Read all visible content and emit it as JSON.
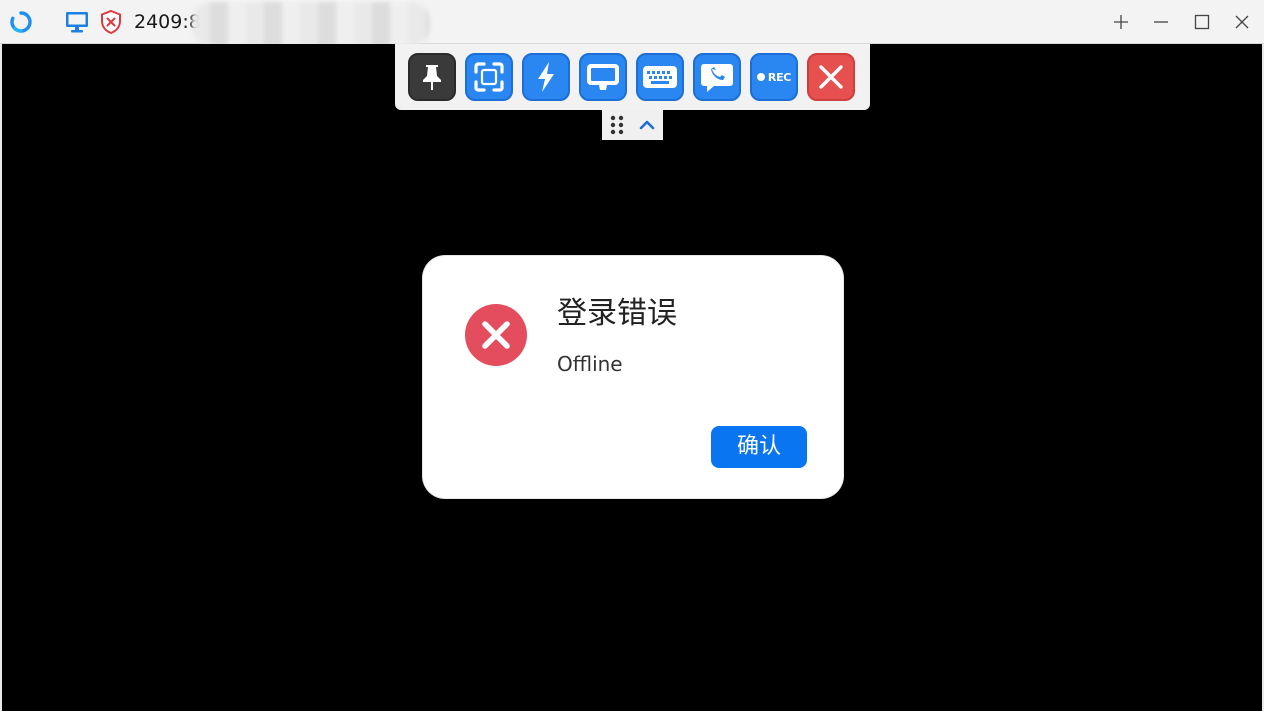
{
  "titlebar": {
    "address": "2409:8",
    "icons": [
      "app-logo-icon",
      "monitor-icon",
      "shield-error-icon"
    ],
    "window_controls": [
      "plus-icon",
      "minimize-icon",
      "maximize-icon",
      "close-icon"
    ]
  },
  "toolbar": {
    "buttons": [
      "pin-icon",
      "fullscreen-icon",
      "lightning-icon",
      "display-icon",
      "keyboard-icon",
      "chat-call-icon",
      "record-icon",
      "close-icon"
    ],
    "record_label": "REC"
  },
  "toolbar_handle": {
    "icons": [
      "drag-grip-icon",
      "chevron-up-icon"
    ]
  },
  "dialog": {
    "title": "登录错误",
    "message": "Offline",
    "ok_label": "确认",
    "icon": "error-icon"
  },
  "colors": {
    "accent_blue": "#2a86f0",
    "error_red": "#e34d5e",
    "ok_blue": "#0a75f1"
  }
}
